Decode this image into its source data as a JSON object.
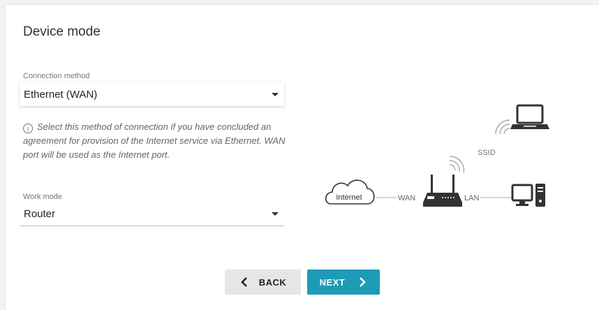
{
  "page": {
    "title": "Device mode"
  },
  "connection_method": {
    "label": "Connection method",
    "value": "Ethernet (WAN)"
  },
  "hint": {
    "text": "Select this method of connection if you have concluded an agreement for provision of the Internet service via Ethernet. WAN port will be used as the Internet port."
  },
  "work_mode": {
    "label": "Work mode",
    "value": "Router"
  },
  "diagram": {
    "internet": "Internet",
    "wan": "WAN",
    "lan": "LAN",
    "ssid": "SSID"
  },
  "buttons": {
    "back": "BACK",
    "next": "NEXT"
  },
  "colors": {
    "accent": "#1e9bb6",
    "secondary_button": "#e6e6e6"
  }
}
